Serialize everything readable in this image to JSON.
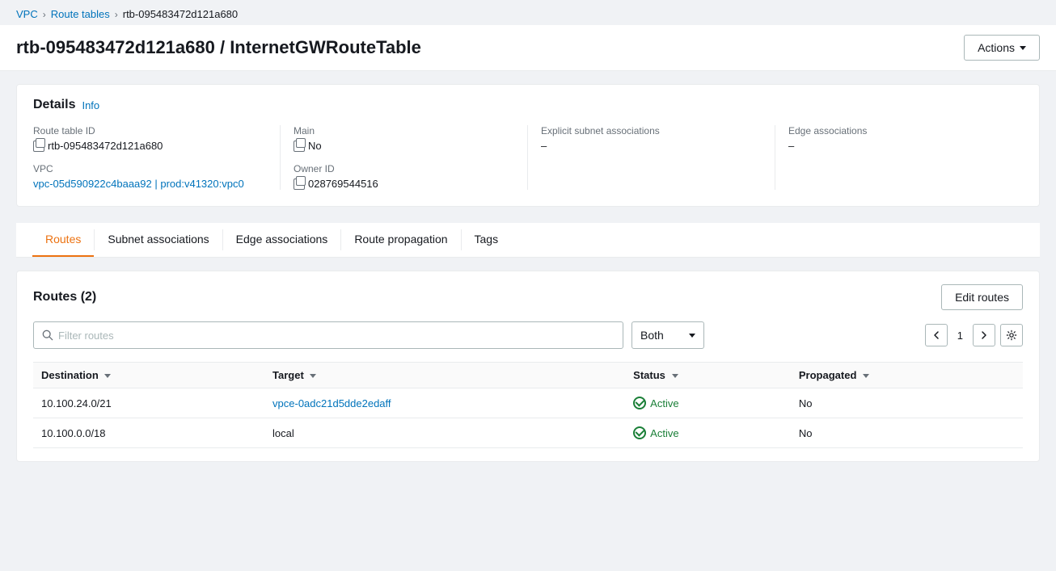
{
  "breadcrumbs": {
    "items": [
      {
        "label": "VPC",
        "link": true
      },
      {
        "label": "Route tables",
        "link": true
      },
      {
        "label": "rtb-095483472d121a680",
        "link": false
      }
    ]
  },
  "page": {
    "title": "rtb-095483472d121a680 / InternetGWRouteTable",
    "actions_label": "Actions"
  },
  "details": {
    "section_title": "Details",
    "info_label": "Info",
    "fields": {
      "route_table_id_label": "Route table ID",
      "route_table_id_value": "rtb-095483472d121a680",
      "main_label": "Main",
      "main_value": "No",
      "explicit_subnet_label": "Explicit subnet associations",
      "explicit_subnet_value": "–",
      "edge_associations_label": "Edge associations",
      "edge_associations_value": "–",
      "vpc_label": "VPC",
      "vpc_value": "vpc-05d590922c4baaa92 | prod:v41320:vpc0",
      "owner_id_label": "Owner ID",
      "owner_id_value": "028769544516"
    }
  },
  "tabs": [
    {
      "label": "Routes",
      "active": true
    },
    {
      "label": "Subnet associations",
      "active": false
    },
    {
      "label": "Edge associations",
      "active": false
    },
    {
      "label": "Route propagation",
      "active": false
    },
    {
      "label": "Tags",
      "active": false
    }
  ],
  "routes": {
    "title": "Routes",
    "count": "(2)",
    "edit_button_label": "Edit routes",
    "filter_placeholder": "Filter routes",
    "dropdown_label": "Both",
    "page_number": "1",
    "columns": [
      {
        "label": "Destination"
      },
      {
        "label": "Target"
      },
      {
        "label": "Status"
      },
      {
        "label": "Propagated"
      }
    ],
    "rows": [
      {
        "destination": "10.100.24.0/21",
        "target": "vpce-0adc21d5dde2edaff",
        "target_link": true,
        "status": "Active",
        "propagated": "No"
      },
      {
        "destination": "10.100.0.0/18",
        "target": "local",
        "target_link": false,
        "status": "Active",
        "propagated": "No"
      }
    ]
  },
  "colors": {
    "active_tab": "#ec7211",
    "link": "#0073bb",
    "active_status": "#1a7f37"
  }
}
